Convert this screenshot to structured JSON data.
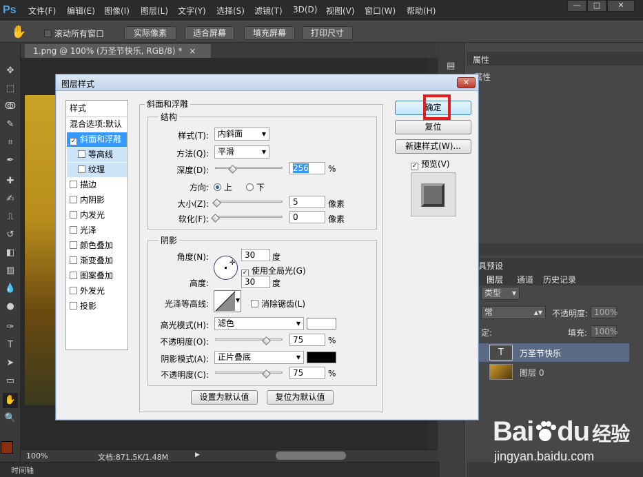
{
  "app": {
    "logo": "Ps"
  },
  "menubar": {
    "items": [
      "文件(F)",
      "编辑(E)",
      "图像(I)",
      "图层(L)",
      "文字(Y)",
      "选择(S)",
      "滤镜(T)",
      "3D(D)",
      "视图(V)",
      "窗口(W)",
      "帮助(H)"
    ]
  },
  "window_controls": {
    "minimize": "—",
    "maximize": "□",
    "close": "✕"
  },
  "optionsbar": {
    "scroll_all": "滚动所有窗口",
    "actual_pixels": "实际像素",
    "fit_screen": "适合屏幕",
    "fill_screen": "填充屏幕",
    "print_size": "打印尺寸"
  },
  "document": {
    "tab_title": "1.png @ 100% (万圣节快乐, RGB/8) *",
    "tab_close": "×"
  },
  "statusbar": {
    "zoom": "100%",
    "doc_info": "文档:871.5K/1.48M"
  },
  "timeline": {
    "label": "时间轴"
  },
  "panels": {
    "properties_tab": "属性",
    "properties_title": "属性",
    "tool_presets_tab": "具预设",
    "layers_tabs": [
      "图层",
      "通道",
      "历史记录"
    ],
    "filter_kind": "类型",
    "blend_mode": "常",
    "opacity_label": "不透明度:",
    "opacity_value": "100%",
    "lock_label": "定:",
    "fill_label": "填充:",
    "fill_value": "100%",
    "layers": [
      {
        "name": "万圣节快乐",
        "thumb": "T"
      },
      {
        "name": "图层 0",
        "thumb": ""
      }
    ]
  },
  "dialog": {
    "title": "图层样式",
    "close": "✕",
    "style_list": {
      "header": "样式",
      "blend_options": "混合选项:默认",
      "items": [
        {
          "label": "斜面和浮雕",
          "checked": "✓",
          "selected": true
        },
        {
          "label": "等高线",
          "checked": "",
          "sub": true
        },
        {
          "label": "纹理",
          "checked": "",
          "sub": true
        },
        {
          "label": "描边",
          "checked": ""
        },
        {
          "label": "内阴影",
          "checked": ""
        },
        {
          "label": "内发光",
          "checked": ""
        },
        {
          "label": "光泽",
          "checked": ""
        },
        {
          "label": "颜色叠加",
          "checked": ""
        },
        {
          "label": "渐变叠加",
          "checked": ""
        },
        {
          "label": "图案叠加",
          "checked": ""
        },
        {
          "label": "外发光",
          "checked": ""
        },
        {
          "label": "投影",
          "checked": ""
        }
      ]
    },
    "bevel": {
      "group_title": "斜面和浮雕",
      "structure_title": "结构",
      "style_label": "样式(T):",
      "style_value": "内斜面",
      "technique_label": "方法(Q):",
      "technique_value": "平滑",
      "depth_label": "深度(D):",
      "depth_value": "256",
      "depth_unit": "%",
      "depth_fraction": 0.26,
      "direction_label": "方向:",
      "dir_up": "上",
      "dir_down": "下",
      "size_label": "大小(Z):",
      "size_value": "5",
      "size_unit": "像素",
      "size_fraction": 0.02,
      "soften_label": "软化(F):",
      "soften_value": "0",
      "soften_unit": "像素",
      "soften_fraction": 0.0
    },
    "shading": {
      "title": "阴影",
      "angle_label": "角度(N):",
      "angle_value": "30",
      "angle_unit": "度",
      "global_light": "使用全局光(G)",
      "global_light_checked": "✓",
      "altitude_label": "高度:",
      "altitude_value": "30",
      "altitude_unit": "度",
      "gloss_contour_label": "光泽等高线:",
      "anti_aliased": "消除锯齿(L)",
      "highlight_mode_label": "高光模式(H):",
      "highlight_mode_value": "滤色",
      "highlight_color": "#ffffff",
      "highlight_opacity_label": "不透明度(O):",
      "highlight_opacity_value": "75",
      "highlight_opacity_unit": "%",
      "highlight_opacity_fraction": 0.75,
      "shadow_mode_label": "阴影模式(A):",
      "shadow_mode_value": "正片叠底",
      "shadow_color": "#000000",
      "shadow_opacity_label": "不透明度(C):",
      "shadow_opacity_value": "75",
      "shadow_opacity_unit": "%",
      "shadow_opacity_fraction": 0.75
    },
    "buttons": {
      "make_default": "设置为默认值",
      "reset_default": "复位为默认值",
      "ok": "确定",
      "reset": "复位",
      "new_style": "新建样式(W)...",
      "preview": "预览(V)",
      "preview_checked": "✓"
    }
  },
  "watermark": {
    "brand": "Bai",
    "du": "du",
    "cn": "经验",
    "url": "jingyan.baidu.com"
  },
  "colors": {
    "accent_red": "#e81c1c",
    "selection_blue": "#3399ff",
    "foreground": "#8b2e0e",
    "background": "#ffffff"
  }
}
